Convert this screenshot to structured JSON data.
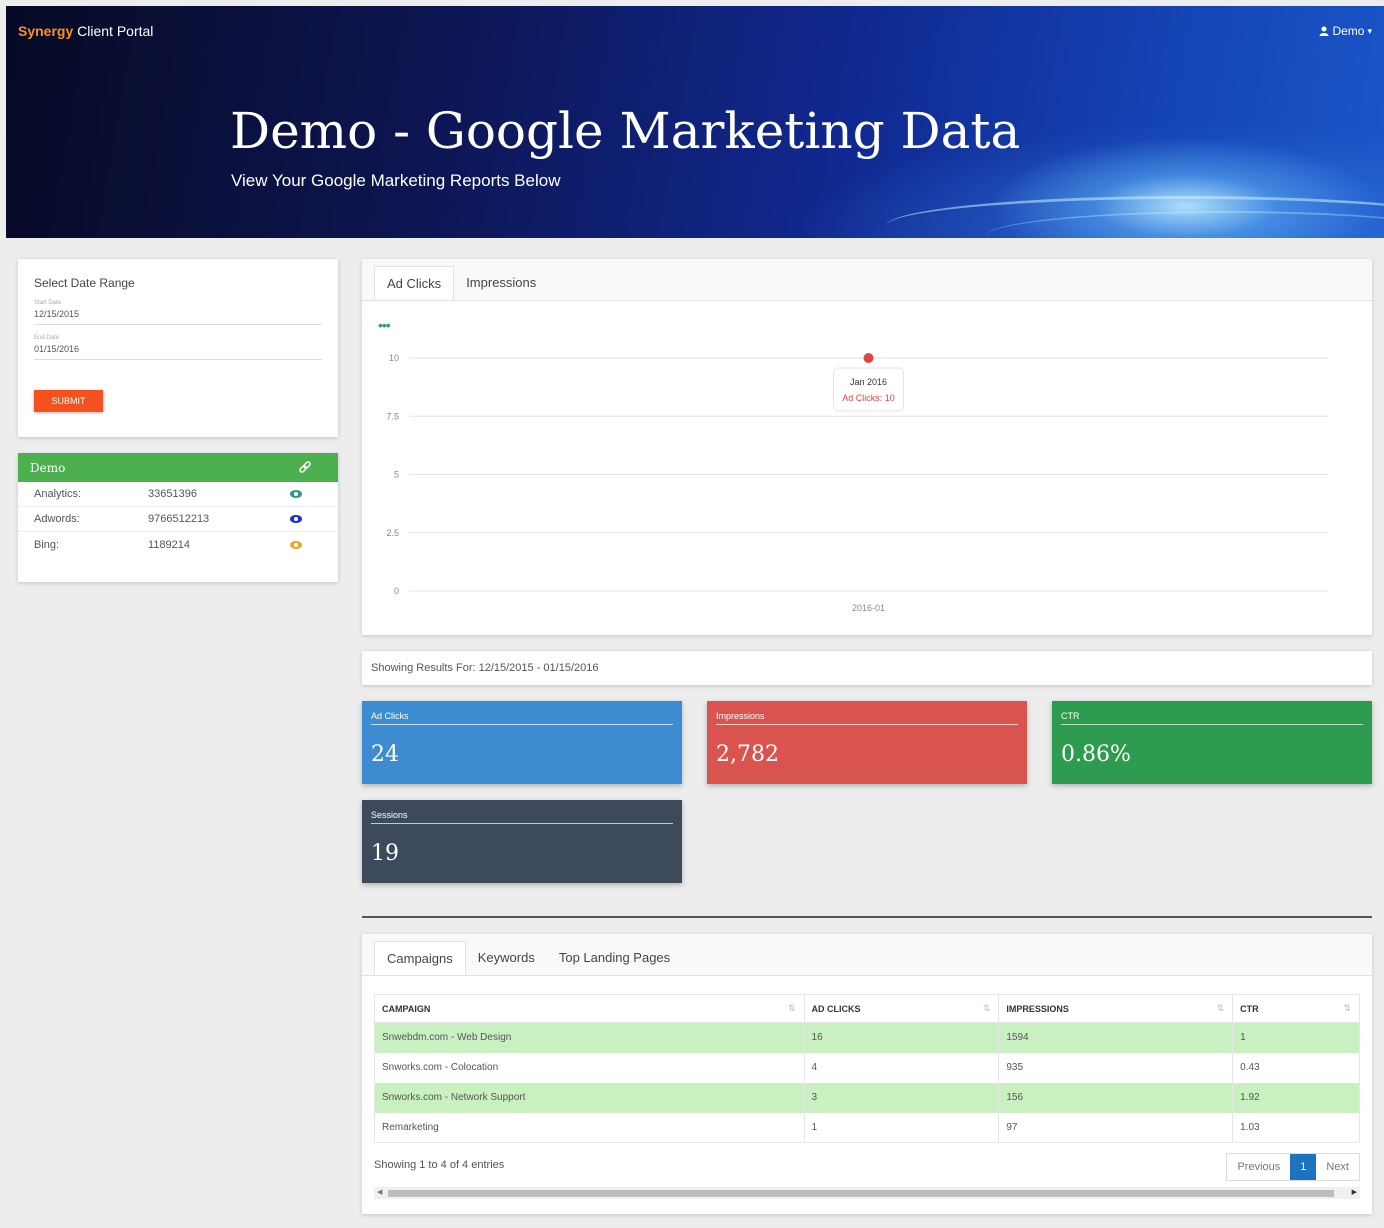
{
  "header": {
    "brand_part1": "Synergy",
    "brand_part2": " Client Portal",
    "user": "Demo",
    "title": "Demo - Google Marketing Data",
    "subtitle": "View Your Google Marketing Reports Below"
  },
  "date_range": {
    "heading": "Select Date Range",
    "start_label": "Start Date",
    "start_value": "12/15/2015",
    "end_label": "End Date",
    "end_value": "01/15/2016",
    "submit_label": "SUBMIT"
  },
  "account": {
    "name": "Demo",
    "rows": [
      {
        "label": "Analytics:",
        "value": "33651396",
        "eye_color": "#2e9c7c"
      },
      {
        "label": "Adwords:",
        "value": "9766512213",
        "eye_color": "#1f2fd6"
      },
      {
        "label": "Bing:",
        "value": "1189214",
        "eye_color": "#f5a623"
      }
    ]
  },
  "chart_tabs": [
    "Ad Clicks",
    "Impressions"
  ],
  "chart_data": {
    "type": "line",
    "x": [
      "2016-01"
    ],
    "series": [
      {
        "name": "Ad Clicks",
        "values": [
          10
        ]
      }
    ],
    "xlabel": "",
    "ylabel": "",
    "ylim": [
      0,
      10
    ],
    "yticks": [
      "0",
      "2.5",
      "5",
      "7.5",
      "10"
    ],
    "xticks": [
      "2016-01"
    ],
    "tooltip": {
      "title": "Jan 2016",
      "text": "Ad Clicks: 10"
    },
    "grid": true,
    "color": "#e04545"
  },
  "results_text": "Showing Results For: 12/15/2015 - 01/15/2016",
  "stats": [
    {
      "label": "Ad Clicks",
      "value": "24",
      "color": "#3d8bd1"
    },
    {
      "label": "Impressions",
      "value": "2,782",
      "color": "#d9534f"
    },
    {
      "label": "CTR",
      "value": "0.86%",
      "color": "#2e9c4e"
    },
    {
      "label": "Sessions",
      "value": "19",
      "color": "#3d4a5c"
    }
  ],
  "table_tabs": [
    "Campaigns",
    "Keywords",
    "Top Landing Pages"
  ],
  "table": {
    "headers": [
      "CAMPAIGN",
      "AD CLICKS",
      "IMPRESSIONS",
      "CTR"
    ],
    "rows": [
      [
        "Snwebdm.com - Web Design",
        "16",
        "1594",
        "1"
      ],
      [
        "Snworks.com - Colocation",
        "4",
        "935",
        "0.43"
      ],
      [
        "Snworks.com - Network Support",
        "3",
        "156",
        "1.92"
      ],
      [
        "Remarketing",
        "1",
        "97",
        "1.03"
      ]
    ],
    "showing": "Showing 1 to 4 of 4 entries",
    "pager": {
      "prev": "Previous",
      "current": "1",
      "next": "Next"
    }
  }
}
